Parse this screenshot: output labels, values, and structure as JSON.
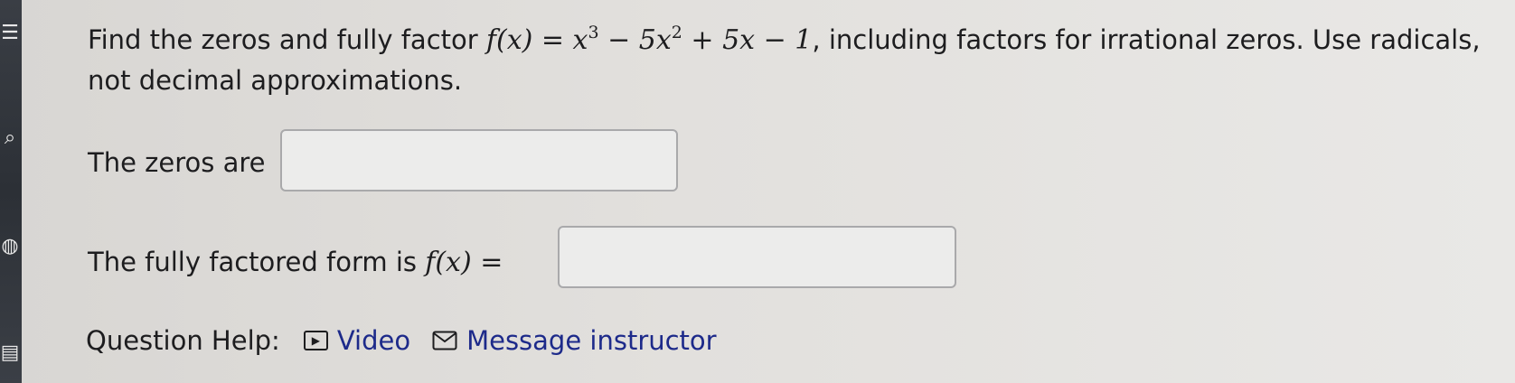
{
  "question": {
    "text_before": "Find the zeros and fully factor ",
    "function_math": "f(x) = x",
    "exp3": "3",
    "mid": " − 5x",
    "exp2": "2",
    "end_math": " + 5x − 1",
    "text_after": ", including factors for irrational zeros. Use radicals, not decimal approximations."
  },
  "zeros": {
    "label": "The zeros are",
    "value": ""
  },
  "factored": {
    "label": "The fully factored form is ",
    "math": "f(x) =",
    "value": ""
  },
  "help": {
    "label": "Question Help:",
    "video_icon": "play-icon",
    "video_label": "Video",
    "message_icon": "envelope-icon",
    "message_label": "Message instructor"
  },
  "sidebar": {
    "icons": [
      "menu-icon",
      "search-icon",
      "globe-icon",
      "calculator-icon"
    ]
  },
  "colors": {
    "link": "#1d2a8a",
    "sidebar": "#2f333a"
  }
}
